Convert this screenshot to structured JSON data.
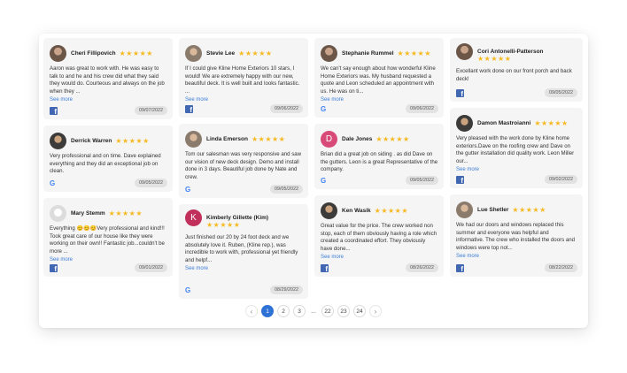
{
  "reviews": [
    {
      "name": "Cheri Fillipovich",
      "stars": "★★★★★",
      "text": "Aaron was great to work with. He was easy to talk to and he and his crew did what they said they would do. Courteous and always on the job when they ...",
      "more": "See more",
      "source": "facebook",
      "date": "09/07/2022"
    },
    {
      "name": "Derrick Warren",
      "stars": "★★★★★",
      "text": "Very professional and on time. Dave explained everything and they did an exceptional job on clean.",
      "source": "google",
      "source_glyph": "G",
      "date": "09/05/2022"
    },
    {
      "name": "Mary Stemm",
      "stars": "★★★★★",
      "text": "Everything 😊😊😊Very professional and kind!!! Took great care of our house like they were working on their own!! Fantastic job...couldn't be more ...",
      "more": "See more",
      "source": "facebook",
      "date": "09/01/2022"
    },
    {
      "name": "Stevie Lee",
      "stars": "★★★★★",
      "text": "If I could give Kline Home Exteriors 10 stars, I would! We are extremely happy with our new, beautiful deck. It is well built and looks fantastic. ...",
      "more": "See more",
      "source": "facebook",
      "date": "09/06/2022"
    },
    {
      "name": "Linda Emerson",
      "stars": "★★★★★",
      "text": "Tom our salesman was very responsive and saw our vision of new deck design. Demo and install done in 3 days. Beautiful job done by Nate and crew.",
      "source": "google",
      "source_glyph": "G",
      "date": "09/05/2022"
    },
    {
      "name": "Kimberly Gillette (Kim)",
      "initial": "K",
      "stars": "★★★★★",
      "text": "Just finished our 20 by 24 foot deck and we absolutely love it. Ruben, (Kline rep.), was incredible to work with, professional yet friendly and helpf...",
      "more": "See more",
      "source": "google",
      "source_glyph": "G",
      "date": "08/29/2022"
    },
    {
      "name": "Stephanie Rummel",
      "stars": "★★★★★",
      "text": "We can't say enough about how wonderful Kline Home Exteriors was. My husband requested a quote and Leon scheduled an appointment with us. He was on ti...",
      "more": "See more",
      "source": "google",
      "source_glyph": "G",
      "date": "09/06/2022"
    },
    {
      "name": "Dale Jones",
      "initial": "D",
      "stars": "★★★★★",
      "text": "Brian did a great job on siding . as did Dave on the gutters. Leon is a great Representative of the company.",
      "source": "google",
      "source_glyph": "G",
      "date": "09/05/2022"
    },
    {
      "name": "Ken Wasik",
      "stars": "★★★★★",
      "text": "Great value for the price. The crew worked non stop, each of them obviously having a role which created a coordinated effort. They obviously have done...",
      "more": "See more",
      "source": "facebook",
      "date": "08/26/2022"
    },
    {
      "name": "Cori Antonelli-Patterson",
      "stars": "★★★★★",
      "text": "Excellant work done on our front porch and back deck!",
      "source": "facebook",
      "date": "09/05/2022"
    },
    {
      "name": "Damon Mastroianni",
      "stars": "★★★★★",
      "text": "Very pleased with the work done by Kline home exteriors.Dave on the roofing crew and Dave on the gutter installation did quality work. Leon Miller our...",
      "more": "See more",
      "source": "facebook",
      "date": "09/02/2022"
    },
    {
      "name": "Lue Shetler",
      "stars": "★★★★★",
      "text": "We had our doors and windows replaced this summer and everyone was helpful and informative. The crew who installed the doors and windows were top not...",
      "more": "See more",
      "source": "facebook",
      "date": "08/22/2022"
    }
  ],
  "pagination": {
    "prev": "‹",
    "pages": [
      "1",
      "2",
      "3"
    ],
    "ellipsis": "...",
    "last_pages": [
      "22",
      "23",
      "24"
    ],
    "next": "›",
    "active": "1"
  },
  "colors": {
    "accent": "#2f72d6",
    "stars": "#f6b921",
    "link": "#3b7dd8",
    "facebook": "#4267b2",
    "google": "#4285f4"
  }
}
